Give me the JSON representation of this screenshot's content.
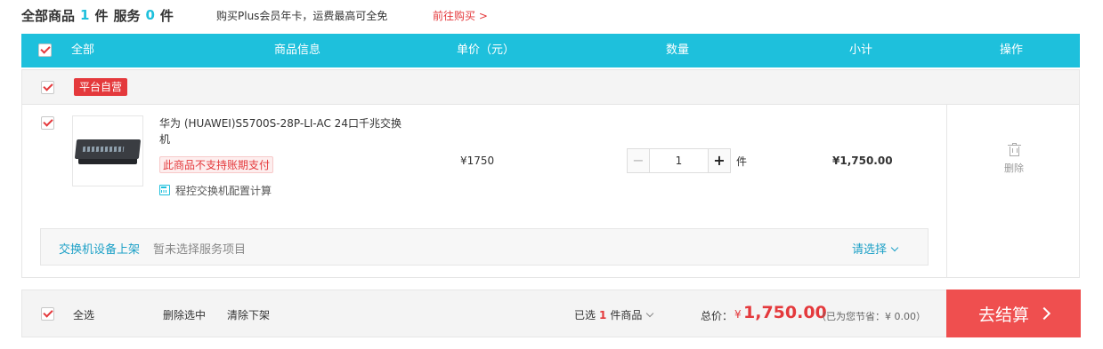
{
  "summary": {
    "all_label": "全部商品",
    "item_count": "1",
    "item_unit": "件",
    "service_label": "服务",
    "service_count": "0",
    "service_unit": "件"
  },
  "promo": {
    "text": "购买Plus会员年卡，运费最高可全免",
    "link": "前往购买 >"
  },
  "table_header": {
    "select_all": "全部",
    "product_info": "商品信息",
    "unit_price": "单价（元）",
    "quantity": "数量",
    "subtotal": "小计",
    "actions": "操作"
  },
  "shop": {
    "badge": "平台自营",
    "checked": true
  },
  "item": {
    "checked": true,
    "name": "华为 (HUAWEI)S5700S-28P-LI-AC 24口千兆交换机",
    "warning": "此商品不支持账期支付",
    "calc_link": "程控交换机配置计算",
    "price": "¥1750",
    "quantity": "1",
    "quantity_unit": "件",
    "subtotal": "¥1,750.00",
    "delete_label": "删除"
  },
  "service": {
    "title": "交换机设备上架",
    "status": "暂未选择服务项目",
    "choose_label": "请选择"
  },
  "footer": {
    "select_all": "全选",
    "delete_selected": "删除选中",
    "clear_removed": "清除下架",
    "selected_prefix": "已选",
    "selected_count": "1",
    "selected_suffix": "件商品",
    "total_label": "总价：",
    "currency": "¥",
    "total_amount": "1,750.00",
    "savings": "（已为您节省：¥ 0.00）",
    "checkout_label": "去结算"
  },
  "colors": {
    "accent": "#1ec0dc",
    "danger": "#e4393c",
    "checkout": "#ef4f4f"
  }
}
